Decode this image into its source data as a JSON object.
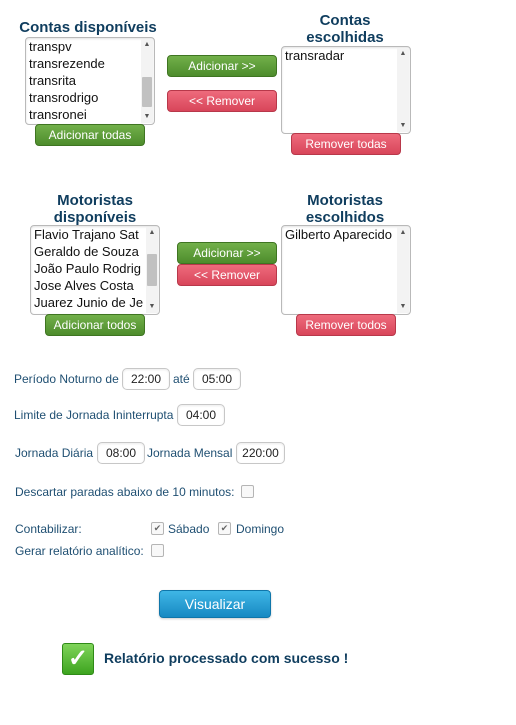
{
  "contas": {
    "available_title": "Contas disponíveis",
    "chosen_title": "Contas escolhidas",
    "available": [
      "transpv",
      "transrezende",
      "transrita",
      "transrodrigo",
      "transronei"
    ],
    "chosen": [
      "transradar"
    ],
    "add_label": "Adicionar >>",
    "remove_label": "<< Remover",
    "add_all_label": "Adicionar todas",
    "remove_all_label": "Remover todas"
  },
  "motoristas": {
    "available_title": "Motoristas disponíveis",
    "chosen_title": "Motoristas escolhidos",
    "available": [
      "Flavio Trajano Sat",
      "Geraldo de Souza",
      "João Paulo Rodrig",
      "Jose Alves Costa",
      "Juarez Junio de Je"
    ],
    "chosen": [
      "Gilberto Aparecido"
    ],
    "add_label": "Adicionar >>",
    "remove_label": "<< Remover",
    "add_all_label": "Adicionar todos",
    "remove_all_label": "Remover todos"
  },
  "form": {
    "periodo_label": "Período Noturno de",
    "periodo_from": "22:00",
    "ate_label": "até",
    "periodo_to": "05:00",
    "limite_label": "Limite de Jornada Ininterrupta",
    "limite_value": "04:00",
    "jornada_diaria_label": "Jornada Diária",
    "jornada_diaria_value": "08:00",
    "jornada_mensal_label": "Jornada Mensal",
    "jornada_mensal_value": "220:00",
    "descartar_label": "Descartar paradas abaixo de 10 minutos:",
    "contabilizar_label": "Contabilizar:",
    "sabado_label": "Sábado",
    "domingo_label": "Domingo",
    "relatorio_label": "Gerar relatório analítico:",
    "visualizar_label": "Visualizar"
  },
  "status": {
    "message": "Relatório processado com sucesso !",
    "icon": "checkmark-icon"
  }
}
